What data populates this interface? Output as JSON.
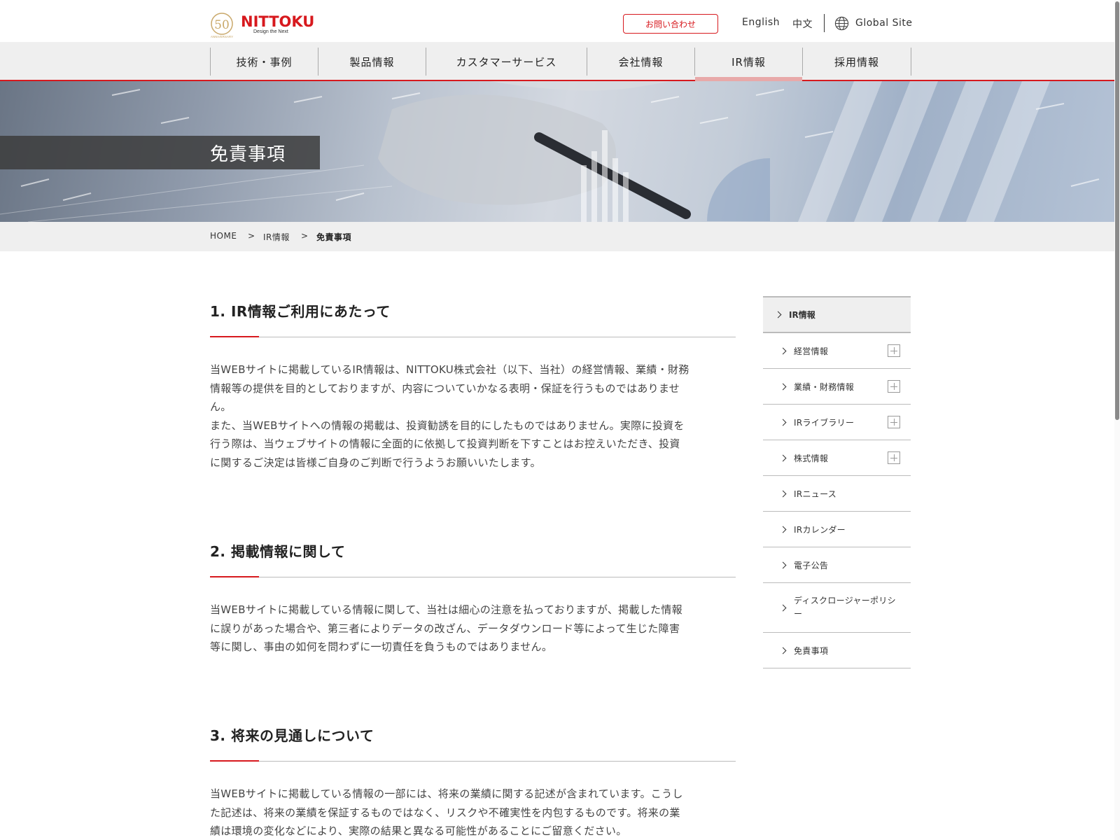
{
  "header": {
    "brand": "NITTOKU",
    "tagline": "Design the Next",
    "anniversary_number": "50",
    "anniversary_label": "ANNIVERSARY",
    "contact_label": "お問い合わせ",
    "lang_english": "English",
    "lang_chinese": "中文",
    "global_site": "Global Site"
  },
  "nav": {
    "items": [
      {
        "label": "技術・事例"
      },
      {
        "label": "製品情報"
      },
      {
        "label": "カスタマーサービス"
      },
      {
        "label": "会社情報"
      },
      {
        "label": "IR情報"
      },
      {
        "label": "採用情報"
      }
    ],
    "active": "IR情報"
  },
  "hero": {
    "title": "免責事項"
  },
  "breadcrumb": {
    "home": "HOME",
    "sep": ">",
    "parent": "IR情報",
    "current": "免責事項"
  },
  "sections": [
    {
      "heading": "1. IR情報ご利用にあたって",
      "lines": [
        "当WEBサイトに掲載しているIR情報は、NITTOKU株式会社（以下、当社）の経営情報、業績・財務",
        "情報等の提供を目的としておりますが、内容についていかなる表明・保証を行うものではありませ",
        "ん。",
        "また、当WEBサイトへの情報の掲載は、投資勧誘を目的にしたものではありません。実際に投資を",
        "行う際は、当ウェブサイトの情報に全面的に依拠して投資判断を下すことはお控えいただき、投資",
        "に関するご決定は皆様ご自身のご判断で行うようお願いいたします。"
      ]
    },
    {
      "heading": "2. 掲載情報に関して",
      "lines": [
        "当WEBサイトに掲載している情報に関して、当社は細心の注意を払っておりますが、掲載した情報",
        "に誤りがあった場合や、第三者によりデータの改ざん、データダウンロード等によって生じた障害",
        "等に関し、事由の如何を問わずに一切責任を負うものではありません。"
      ]
    },
    {
      "heading": "3. 将来の見通しについて",
      "lines": [
        "当WEBサイトに掲載している情報の一部には、将来の業績に関する記述が含まれています。こうし",
        "た記述は、将来の業績を保証するものではなく、リスクや不確実性を内包するものです。将来の業",
        "績は環境の変化などにより、実際の結果と異なる可能性があることにご留意ください。"
      ]
    }
  ],
  "sidebar": {
    "heading": "IR情報",
    "items": [
      {
        "label": "経営情報",
        "expandable": true
      },
      {
        "label": "業績・財務情報",
        "expandable": true
      },
      {
        "label": "IRライブラリー",
        "expandable": true
      },
      {
        "label": "株式情報",
        "expandable": true
      },
      {
        "label": "IRニュース",
        "expandable": false
      },
      {
        "label": "IRカレンダー",
        "expandable": false
      },
      {
        "label": "電子公告",
        "expandable": false
      },
      {
        "label": "ディスクロージャーポリシー",
        "label_line1": "ディスクロージャーポリシ",
        "label_line2": "ー",
        "expandable": false
      },
      {
        "label": "免責事項",
        "expandable": false
      }
    ]
  },
  "colors": {
    "accent": "#d7191e",
    "nav_bg": "#efefef",
    "text": "#333333",
    "active_tab_bar": "#e8a9a9"
  }
}
